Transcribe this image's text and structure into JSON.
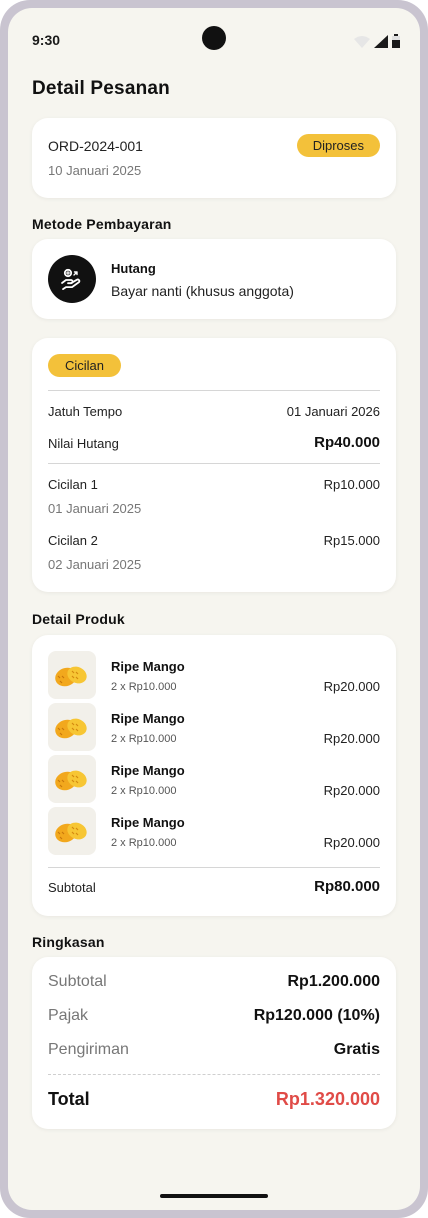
{
  "status_bar": {
    "time": "9:30"
  },
  "page": {
    "title": "Detail Pesanan"
  },
  "order": {
    "id": "ORD-2024-001",
    "date": "10 Januari 2025",
    "status": "Diproses"
  },
  "payment": {
    "section_title": "Metode Pembayaran",
    "icon": "hand-coin-icon",
    "name": "Hutang",
    "description": "Bayar nanti (khusus anggota)"
  },
  "installment": {
    "badge": "Cicilan",
    "due_label": "Jatuh Tempo",
    "due_value": "01 Januari 2026",
    "debt_label": "Nilai Hutang",
    "debt_value": "Rp40.000",
    "items": [
      {
        "label": "Cicilan 1",
        "amount": "Rp10.000",
        "date": "01 Januari 2025"
      },
      {
        "label": "Cicilan 2",
        "amount": "Rp15.000",
        "date": "02 Januari 2025"
      }
    ]
  },
  "products": {
    "section_title": "Detail Produk",
    "items": [
      {
        "name": "Ripe Mango",
        "qty": "2 x Rp10.000",
        "price": "Rp20.000",
        "icon": "mango-icon"
      },
      {
        "name": "Ripe Mango",
        "qty": "2 x Rp10.000",
        "price": "Rp20.000",
        "icon": "mango-icon"
      },
      {
        "name": "Ripe Mango",
        "qty": "2 x Rp10.000",
        "price": "Rp20.000",
        "icon": "mango-icon"
      },
      {
        "name": "Ripe Mango",
        "qty": "2 x Rp10.000",
        "price": "Rp20.000",
        "icon": "mango-icon"
      }
    ],
    "subtotal_label": "Subtotal",
    "subtotal_value": "Rp80.000"
  },
  "summary": {
    "section_title": "Ringkasan",
    "subtotal_label": "Subtotal",
    "subtotal_value": "Rp1.200.000",
    "tax_label": "Pajak",
    "tax_value": "Rp120.000 (10%)",
    "shipping_label": "Pengiriman",
    "shipping_value": "Gratis",
    "total_label": "Total",
    "total_value": "Rp1.320.000"
  },
  "colors": {
    "accent": "#f3c13a",
    "total": "#e04b47",
    "background": "#f6f5ef"
  }
}
